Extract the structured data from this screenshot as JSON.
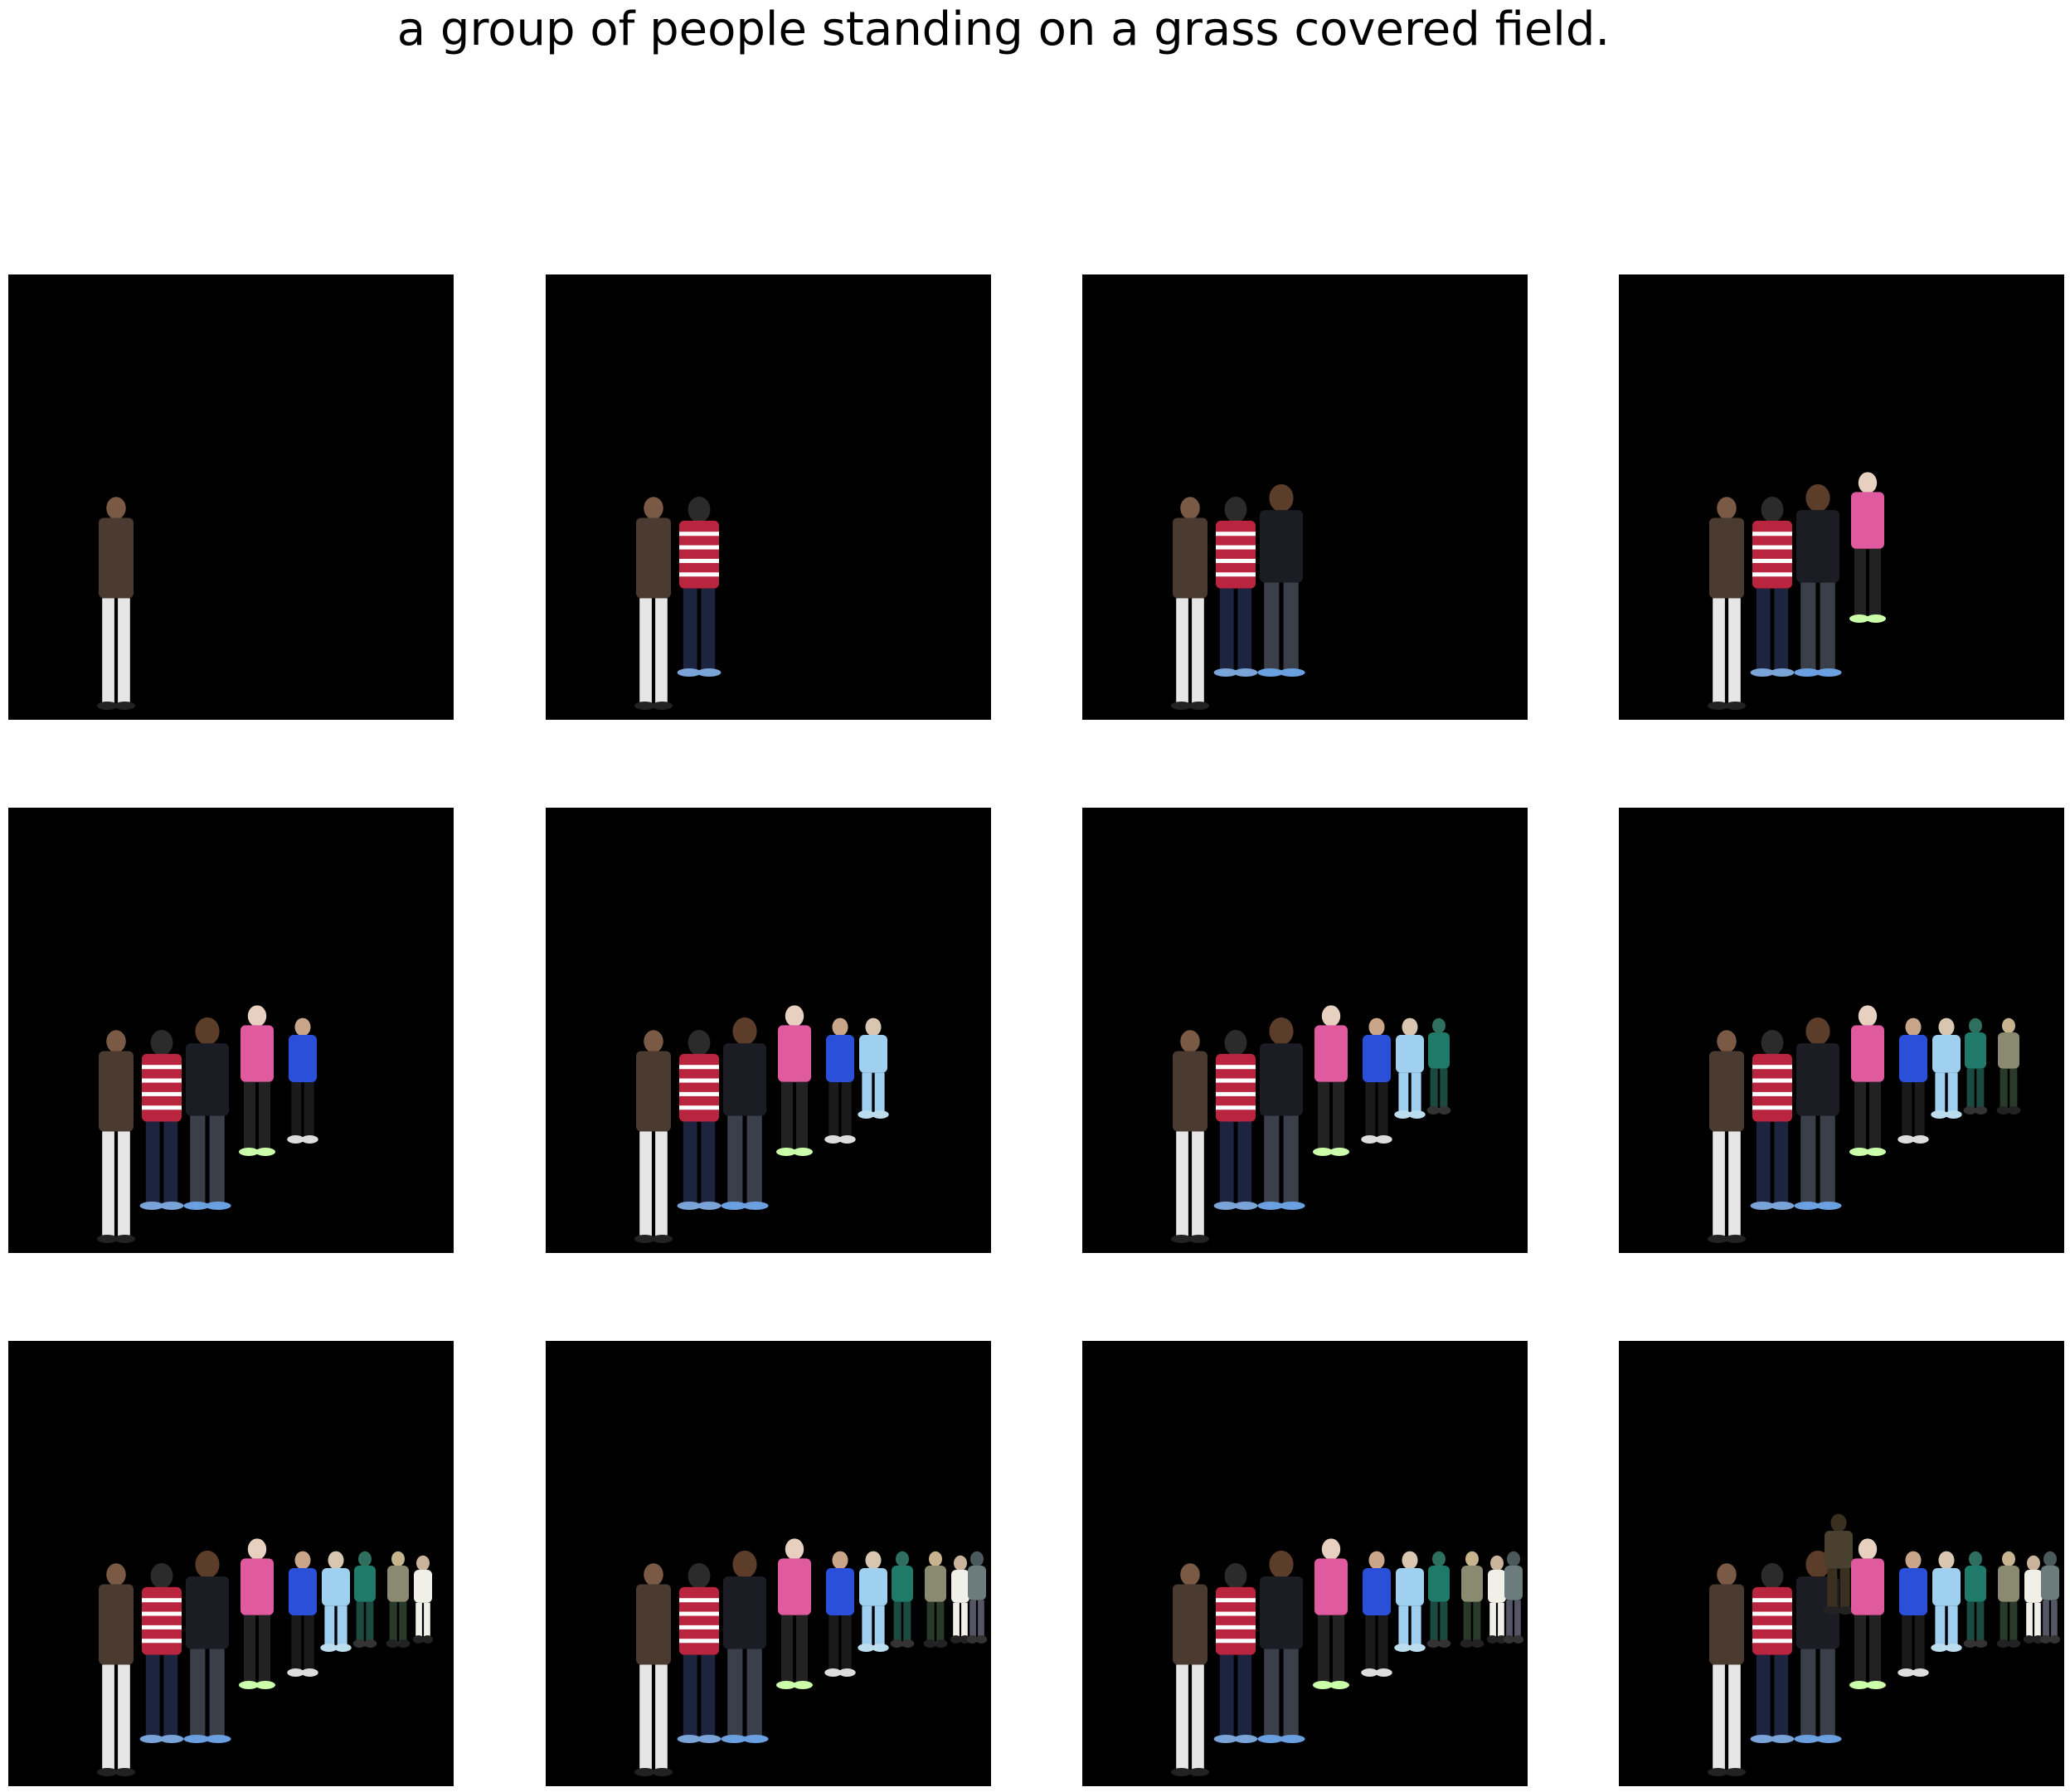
{
  "caption": "a group of people standing on a grass covered field.",
  "colors": {
    "background": "#ffffff",
    "panel_background": "#000000"
  },
  "panels": [
    {
      "people_shown": 1
    },
    {
      "people_shown": 2
    },
    {
      "people_shown": 3
    },
    {
      "people_shown": 4
    },
    {
      "people_shown": 5
    },
    {
      "people_shown": 6
    },
    {
      "people_shown": 7
    },
    {
      "people_shown": 8
    },
    {
      "people_shown": 9
    },
    {
      "people_shown": 10
    },
    {
      "people_shown": 10
    },
    {
      "people_shown": 11
    }
  ]
}
